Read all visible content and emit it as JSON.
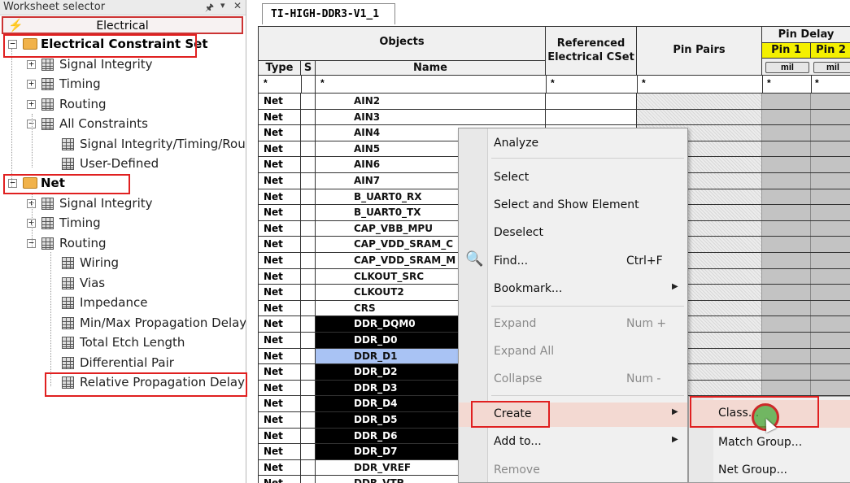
{
  "left_pane": {
    "title": "Worksheet selector",
    "active_tab": "Electrical",
    "tree": [
      {
        "label": "Electrical Constraint Set",
        "level": 0,
        "kind": "folder",
        "bold": true,
        "expander": "minus"
      },
      {
        "label": "Signal Integrity",
        "level": 1,
        "kind": "grid",
        "expander": "plus"
      },
      {
        "label": "Timing",
        "level": 1,
        "kind": "grid",
        "expander": "plus"
      },
      {
        "label": "Routing",
        "level": 1,
        "kind": "grid",
        "expander": "plus"
      },
      {
        "label": "All Constraints",
        "level": 1,
        "kind": "grid",
        "expander": "minus"
      },
      {
        "label": "Signal Integrity/Timing/Rout",
        "level": 2,
        "kind": "grid"
      },
      {
        "label": "User-Defined",
        "level": 2,
        "kind": "grid"
      },
      {
        "label": "Net",
        "level": 0,
        "kind": "folder",
        "bold": true,
        "expander": "minus"
      },
      {
        "label": "Signal Integrity",
        "level": 1,
        "kind": "grid",
        "expander": "plus"
      },
      {
        "label": "Timing",
        "level": 1,
        "kind": "grid",
        "expander": "plus"
      },
      {
        "label": "Routing",
        "level": 1,
        "kind": "grid",
        "expander": "minus"
      },
      {
        "label": "Wiring",
        "level": 2,
        "kind": "grid"
      },
      {
        "label": "Vias",
        "level": 2,
        "kind": "grid"
      },
      {
        "label": "Impedance",
        "level": 2,
        "kind": "grid"
      },
      {
        "label": "Min/Max Propagation Delay",
        "level": 2,
        "kind": "grid"
      },
      {
        "label": "Total Etch Length",
        "level": 2,
        "kind": "grid"
      },
      {
        "label": "Differential Pair",
        "level": 2,
        "kind": "grid"
      },
      {
        "label": "Relative Propagation Delay",
        "level": 2,
        "kind": "grid"
      }
    ]
  },
  "document_tab": {
    "label": "TI-HIGH-DDR3-V1_1"
  },
  "grid": {
    "headers": {
      "objects": "Objects",
      "type": "Type",
      "s": "S",
      "name": "Name",
      "referenced": "Referenced Electrical CSet",
      "pin_pairs": "Pin Pairs",
      "pin_delay": "Pin Delay",
      "pin1": "Pin 1",
      "pin2": "Pin 2",
      "unit": "mil",
      "filter": "*"
    },
    "rows": [
      {
        "type": "Net",
        "name": "AIN2",
        "state": ""
      },
      {
        "type": "Net",
        "name": "AIN3",
        "state": ""
      },
      {
        "type": "Net",
        "name": "AIN4",
        "state": ""
      },
      {
        "type": "Net",
        "name": "AIN5",
        "state": ""
      },
      {
        "type": "Net",
        "name": "AIN6",
        "state": ""
      },
      {
        "type": "Net",
        "name": "AIN7",
        "state": ""
      },
      {
        "type": "Net",
        "name": "B_UART0_RX",
        "state": ""
      },
      {
        "type": "Net",
        "name": "B_UART0_TX",
        "state": ""
      },
      {
        "type": "Net",
        "name": "CAP_VBB_MPU",
        "state": ""
      },
      {
        "type": "Net",
        "name": "CAP_VDD_SRAM_C",
        "state": ""
      },
      {
        "type": "Net",
        "name": "CAP_VDD_SRAM_M",
        "state": ""
      },
      {
        "type": "Net",
        "name": "CLKOUT_SRC",
        "state": ""
      },
      {
        "type": "Net",
        "name": "CLKOUT2",
        "state": ""
      },
      {
        "type": "Net",
        "name": "CRS",
        "state": ""
      },
      {
        "type": "Net",
        "name": "DDR_DQM0",
        "state": "selected"
      },
      {
        "type": "Net",
        "name": "DDR_D0",
        "state": "selected"
      },
      {
        "type": "Net",
        "name": "DDR_D1",
        "state": "highlight"
      },
      {
        "type": "Net",
        "name": "DDR_D2",
        "state": "selected"
      },
      {
        "type": "Net",
        "name": "DDR_D3",
        "state": "selected"
      },
      {
        "type": "Net",
        "name": "DDR_D4",
        "state": "selected"
      },
      {
        "type": "Net",
        "name": "DDR_D5",
        "state": "selected"
      },
      {
        "type": "Net",
        "name": "DDR_D6",
        "state": "selected"
      },
      {
        "type": "Net",
        "name": "DDR_D7",
        "state": "selected"
      },
      {
        "type": "Net",
        "name": "DDR_VREF",
        "state": ""
      },
      {
        "type": "Net",
        "name": "DDR_VTP",
        "state": ""
      }
    ]
  },
  "context_menu": {
    "items": [
      {
        "label": "Analyze",
        "shortcut": "",
        "submenu": false,
        "disabled": false
      },
      {
        "label": "Select",
        "shortcut": "",
        "submenu": false,
        "disabled": false
      },
      {
        "label": "Select and Show Element",
        "shortcut": "",
        "submenu": false,
        "disabled": false
      },
      {
        "label": "Deselect",
        "shortcut": "",
        "submenu": false,
        "disabled": false
      },
      {
        "label": "Find...",
        "shortcut": "Ctrl+F",
        "submenu": false,
        "disabled": false
      },
      {
        "label": "Bookmark...",
        "shortcut": "",
        "submenu": true,
        "disabled": false
      },
      {
        "label": "Expand",
        "shortcut": "Num +",
        "submenu": false,
        "disabled": true
      },
      {
        "label": "Expand All",
        "shortcut": "",
        "submenu": false,
        "disabled": true
      },
      {
        "label": "Collapse",
        "shortcut": "Num -",
        "submenu": false,
        "disabled": true
      },
      {
        "label": "Create",
        "shortcut": "",
        "submenu": true,
        "disabled": false
      },
      {
        "label": "Add to...",
        "shortcut": "",
        "submenu": true,
        "disabled": false
      },
      {
        "label": "Remove",
        "shortcut": "",
        "submenu": false,
        "disabled": true
      }
    ]
  },
  "submenu": {
    "items": [
      {
        "label": "Class..."
      },
      {
        "label": "Match Group..."
      },
      {
        "label": "Net Group..."
      }
    ]
  },
  "icons": {
    "pin": "pin-icon",
    "dropdown": "dropdown-icon",
    "close": "close-icon",
    "electrical": "lightning-bolt-icon",
    "folder": "folder-icon",
    "worksheet": "worksheet-grid-icon",
    "find": "binoculars-icon",
    "submenu_arrow": "chevron-right-icon"
  },
  "colors": {
    "annotation_red": "#e02020",
    "selection_black": "#000000",
    "highlight_blue": "#a9c3f4",
    "pin_header_yellow": "#f4f000",
    "menu_hover": "#f3d9d2"
  }
}
